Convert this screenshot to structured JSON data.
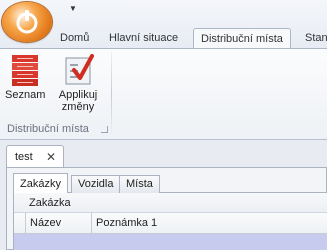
{
  "qat": {
    "dropdown_glyph": "▼"
  },
  "ribbon_tabs": [
    {
      "label": "Domů"
    },
    {
      "label": "Hlavní situace"
    },
    {
      "label": "Distribuční místa",
      "active": true
    },
    {
      "label": "Stan"
    }
  ],
  "ribbon": {
    "buttons": [
      {
        "label_lines": [
          "Seznam"
        ],
        "icon": "list-icon"
      },
      {
        "label_lines": [
          "Applikuj",
          "změny"
        ],
        "icon": "apply-changes-icon"
      }
    ],
    "group_label": "Distribuční místa"
  },
  "document": {
    "tab_label": "test",
    "close_glyph": "✕",
    "inner_tabs": [
      {
        "label": "Zakázky",
        "active": true
      },
      {
        "label": "Vozidla"
      },
      {
        "label": "Místa"
      }
    ],
    "grid": {
      "caption": "Zakázka",
      "columns": [
        "Název",
        "Poznámka 1"
      ]
    }
  },
  "colors": {
    "app_button": "#e37a1c",
    "list_icon_red": "#d9372b",
    "checkmark_red": "#d02c20",
    "selected_row": "#c7ccee"
  }
}
